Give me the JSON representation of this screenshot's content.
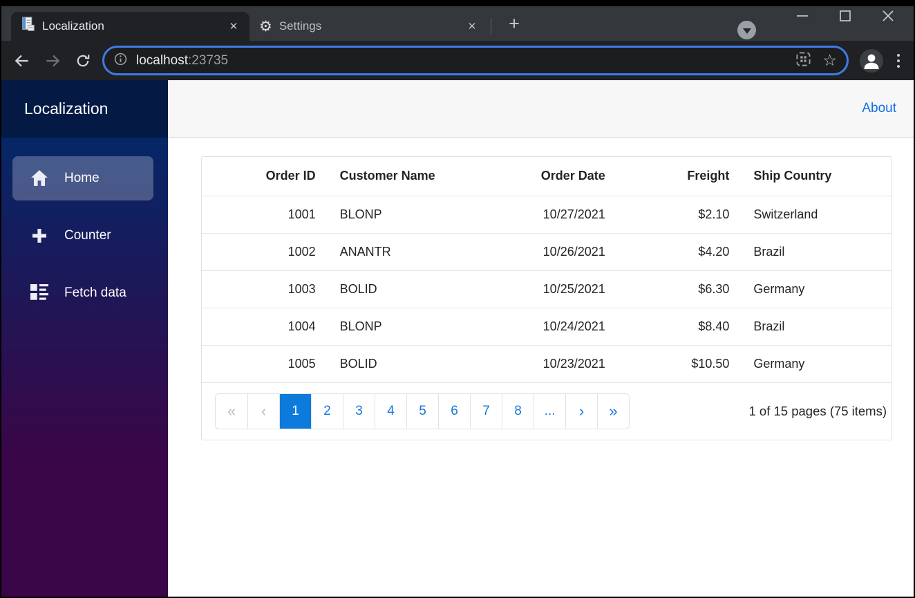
{
  "browser": {
    "tabs": [
      {
        "title": "Localization",
        "favicon": "document-icon",
        "close_glyph": "✕"
      },
      {
        "title": "Settings",
        "favicon": "gear-icon",
        "gear_glyph": "⚙",
        "close_glyph": "✕"
      }
    ],
    "new_tab_glyph": "+",
    "address": {
      "host": "localhost",
      "port": ":23735"
    },
    "bookmark_star_glyph": "☆"
  },
  "sidebar": {
    "brand": "Localization",
    "items": [
      {
        "label": "Home",
        "icon": "home-icon",
        "active": true
      },
      {
        "label": "Counter",
        "icon": "plus-icon",
        "active": false
      },
      {
        "label": "Fetch data",
        "icon": "list-icon",
        "active": false
      }
    ]
  },
  "header": {
    "about_label": "About"
  },
  "grid": {
    "columns": [
      {
        "label": "Order ID",
        "align": "right"
      },
      {
        "label": "Customer Name",
        "align": "left"
      },
      {
        "label": "Order Date",
        "align": "right"
      },
      {
        "label": "Freight",
        "align": "right"
      },
      {
        "label": "Ship Country",
        "align": "left"
      }
    ],
    "rows": [
      [
        "1001",
        "BLONP",
        "10/27/2021",
        "$2.10",
        "Switzerland"
      ],
      [
        "1002",
        "ANANTR",
        "10/26/2021",
        "$4.20",
        "Brazil"
      ],
      [
        "1003",
        "BOLID",
        "10/25/2021",
        "$6.30",
        "Germany"
      ],
      [
        "1004",
        "BLONP",
        "10/24/2021",
        "$8.40",
        "Brazil"
      ],
      [
        "1005",
        "BOLID",
        "10/23/2021",
        "$10.50",
        "Germany"
      ]
    ],
    "pager": {
      "pages": [
        {
          "label": "«",
          "state": "disabled"
        },
        {
          "label": "‹",
          "state": "disabled"
        },
        {
          "label": "1",
          "state": "current"
        },
        {
          "label": "2",
          "state": "normal"
        },
        {
          "label": "3",
          "state": "normal"
        },
        {
          "label": "4",
          "state": "normal"
        },
        {
          "label": "5",
          "state": "normal"
        },
        {
          "label": "6",
          "state": "normal"
        },
        {
          "label": "7",
          "state": "normal"
        },
        {
          "label": "8",
          "state": "normal"
        },
        {
          "label": "...",
          "state": "normal"
        },
        {
          "label": "›",
          "state": "normal"
        },
        {
          "label": "»",
          "state": "normal"
        }
      ],
      "status": "1 of 15 pages (75 items)"
    }
  },
  "colors": {
    "accent_blue": "#0e6fe8",
    "pager_active_bg": "#0d7bdb",
    "sidebar_gradient_top": "#052767",
    "sidebar_gradient_bottom": "#3a0647",
    "brand_bg": "#041a45",
    "chrome_toolbar": "#202124",
    "chrome_frame": "#34373b",
    "omnibox_focus_ring": "#3f7ce8",
    "topbar_bg": "#f7f7f7"
  }
}
